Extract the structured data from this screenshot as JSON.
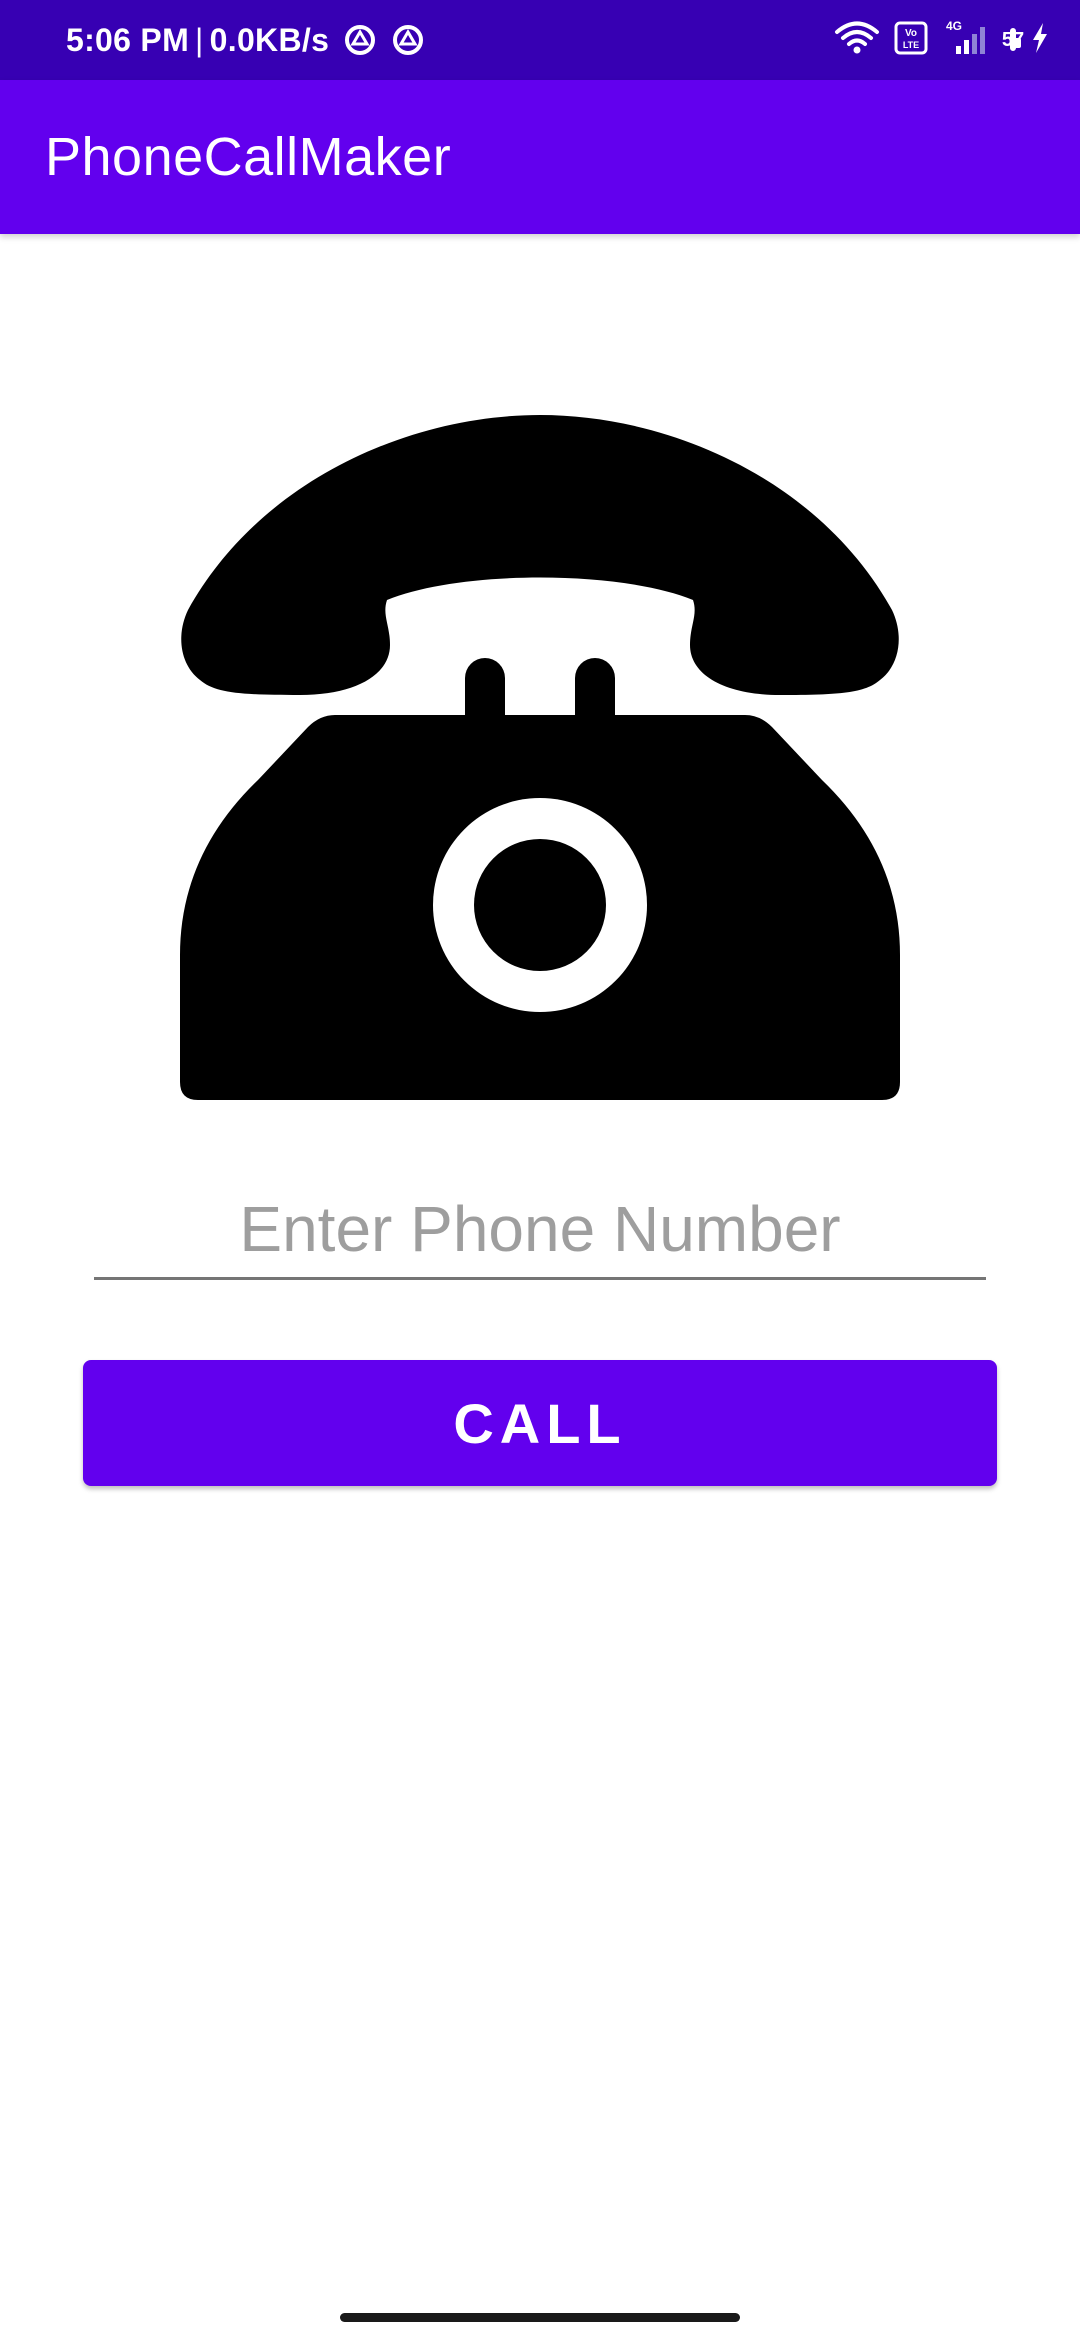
{
  "status_bar": {
    "time": "5:06 PM",
    "separator": "|",
    "network_speed": "0.0KB/s",
    "network_type": "4G",
    "volte_label": "Vo LTE",
    "battery_level": "57",
    "battery_fraction": 0.57,
    "icons": [
      "vpn-circle-icon",
      "vpn-circle-icon",
      "wifi-icon",
      "volte-icon",
      "cell-signal-icon",
      "battery-icon",
      "charging-icon"
    ]
  },
  "app_bar": {
    "title": "PhoneCallMaker",
    "color": "#6200ee"
  },
  "main": {
    "image_icon": "telephone-icon",
    "phone_input": {
      "value": "",
      "placeholder": "Enter Phone Number"
    },
    "call_button": {
      "label": "CALL",
      "color": "#6200ee"
    }
  },
  "colors": {
    "status_bar": "#3700b3",
    "primary": "#6200ee",
    "background": "#ffffff",
    "battery_fill": "#4caf50"
  }
}
